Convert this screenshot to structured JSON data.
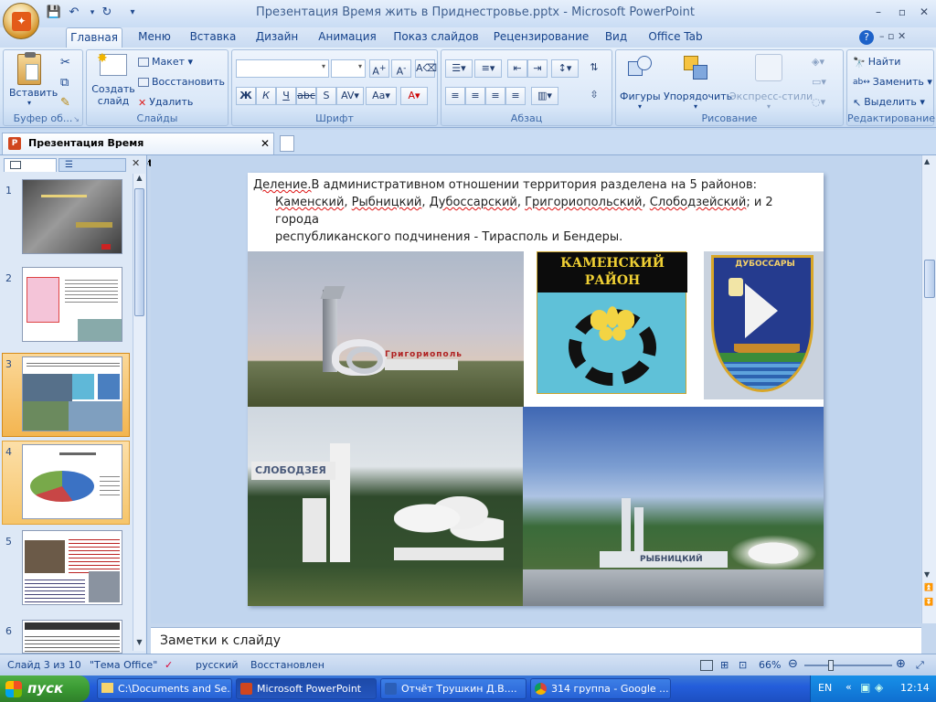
{
  "window": {
    "title": "Презентация  Время жить в Приднестровье.pptx - Microsoft PowerPoint"
  },
  "ribbon_tabs": [
    "Главная",
    "Меню",
    "Вставка",
    "Дизайн",
    "Анимация",
    "Показ слайдов",
    "Рецензирование",
    "Вид",
    "Office Tab"
  ],
  "ribbon": {
    "clipboard": {
      "label": "Буфер об...",
      "paste": "Вставить"
    },
    "slides": {
      "label": "Слайды",
      "new_slide_1": "Создать",
      "new_slide_2": "слайд",
      "layout": "Макет",
      "reset": "Восстановить",
      "delete": "Удалить"
    },
    "font": {
      "label": "Шрифт"
    },
    "paragraph": {
      "label": "Абзац"
    },
    "drawing": {
      "label": "Рисование",
      "shapes": "Фигуры",
      "arrange": "Упорядочить",
      "styles": "Экспресс-стили"
    },
    "editing": {
      "label": "Редактирование",
      "find": "Найти",
      "replace": "Заменить",
      "select": "Выделить"
    }
  },
  "doc_tab": {
    "title": "Презентация  Время ...Приднестровье.pptx"
  },
  "thumbnails": [
    {
      "num": "1"
    },
    {
      "num": "2"
    },
    {
      "num": "3"
    },
    {
      "num": "4"
    },
    {
      "num": "5"
    },
    {
      "num": "6"
    }
  ],
  "slide": {
    "line1_a": "Деление.",
    "line1_b": "В административном отношении территория разделена на 5 районов:",
    "line2_items": [
      "Каменский",
      ", ",
      "Рыбницкий",
      ", ",
      "Дубоссарский",
      ", ",
      "Григориопольский",
      ", ",
      "Слободзейский",
      "; и 2 города"
    ],
    "line3": "республиканского подчинения - Тирасполь и Бендеры.",
    "img_grig_text": "Григориополь",
    "kamen_line1": "КАМЕНСКИЙ",
    "kamen_line2": "РАЙОН",
    "dub_text": "ДУБОССАРЫ",
    "slob_text": "СЛОБОДЗЕЯ",
    "ryb_text": "РЫБНИЦКИЙ"
  },
  "notes": {
    "placeholder": "Заметки к слайду"
  },
  "status": {
    "slide": "Слайд 3 из 10",
    "theme": "\"Тема Office\"",
    "lang": "русский",
    "state": "Восстановлен",
    "zoom": "66%"
  },
  "taskbar": {
    "start": "пуск",
    "items": [
      "C:\\Documents and Se...",
      "Microsoft PowerPoint",
      "Отчёт Трушкин Д.В....",
      "314 группа - Google ..."
    ],
    "lang": "EN",
    "time": "12:14"
  }
}
